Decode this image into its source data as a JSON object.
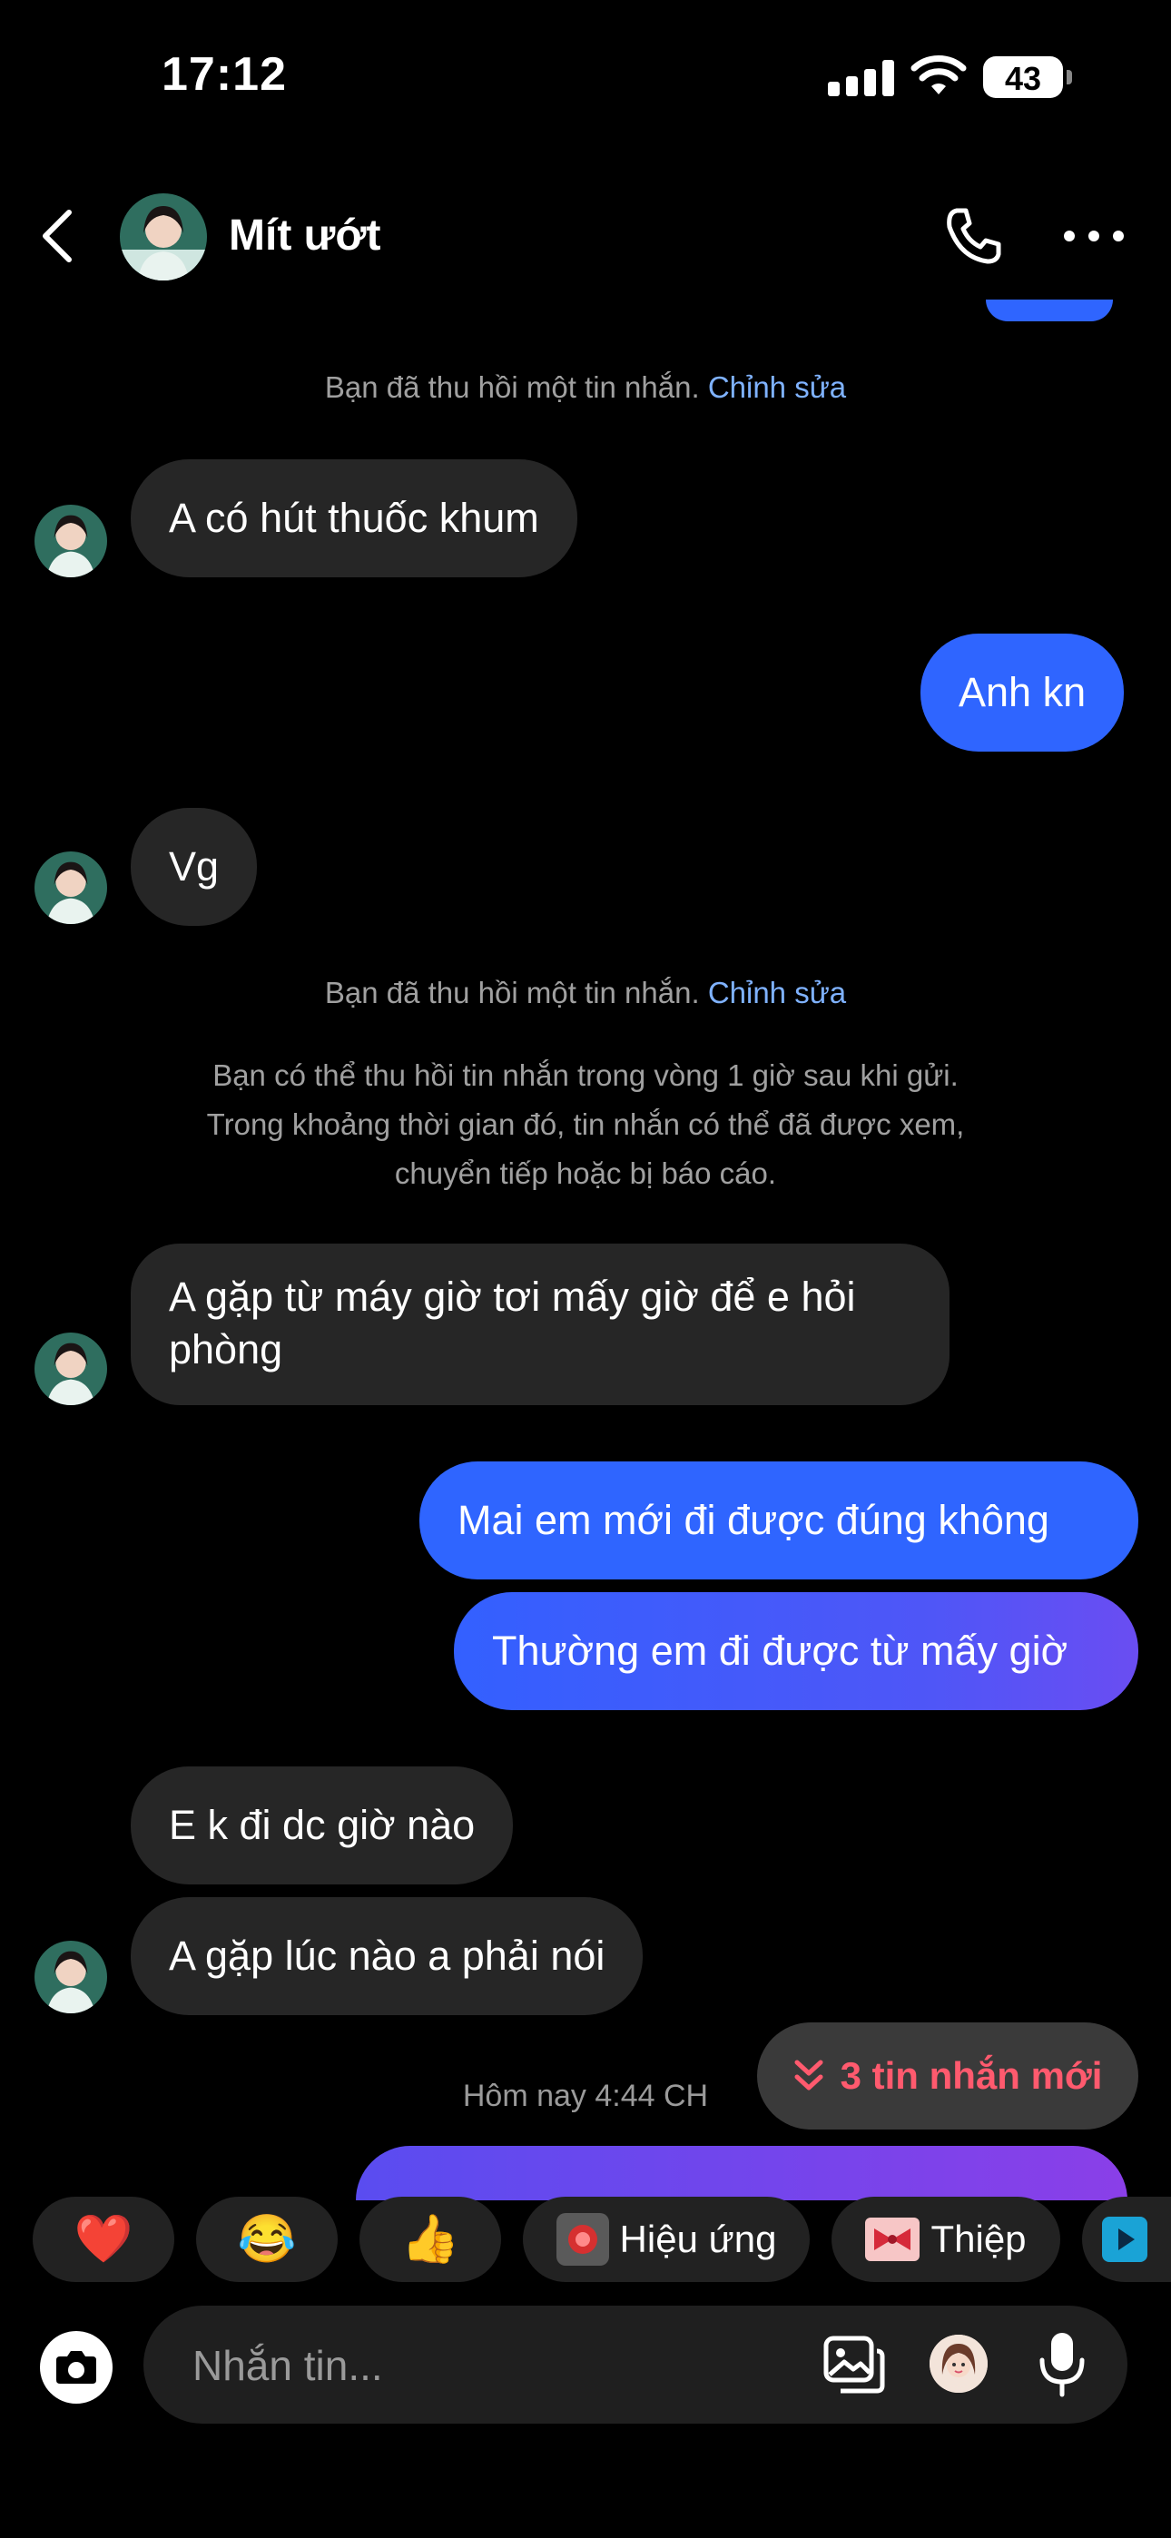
{
  "status_bar": {
    "time": "17:12",
    "battery": "43"
  },
  "header": {
    "contact_name": "Mít ướt"
  },
  "messages": {
    "recall_note_1": "Bạn đã thu hồi một tin nhắn.",
    "recall_edit_1": "Chỉnh sửa",
    "m1": "A có hút thuốc khum",
    "m2": "Anh kn",
    "m3": "Vg",
    "recall_note_2": "Bạn đã thu hồi một tin nhắn.",
    "recall_edit_2": "Chỉnh sửa",
    "info_lines": [
      "Bạn có thể thu hồi tin nhắn trong vòng 1 giờ sau khi gửi.",
      "Trong khoảng thời gian đó, tin nhắn có thể đã được xem,",
      "chuyển tiếp hoặc bị báo cáo."
    ],
    "m4": "A gặp từ máy giờ tơi mấy giờ để e hỏi phòng",
    "m5": "Mai em mới đi được đúng không",
    "m6": "Thường em đi được từ mấy giờ",
    "m7": "E k đi dc giờ nào",
    "m8": "A gặp lúc nào a phải nói",
    "timestamp": "Hôm nay 4:44 CH"
  },
  "new_messages_pill": {
    "label": "3 tin nhắn mới"
  },
  "quick_reactions": {
    "heart": "❤️",
    "laugh": "😂",
    "thumbs_up": "👍",
    "effects": "Hiệu ứng",
    "card": "Thiệp"
  },
  "composer": {
    "placeholder": "Nhắn tin..."
  },
  "colors": {
    "outgoing": "#2f65ff",
    "incoming": "#262626",
    "accent_link": "#7fb2ff",
    "new_msg": "#ff5a6e"
  }
}
